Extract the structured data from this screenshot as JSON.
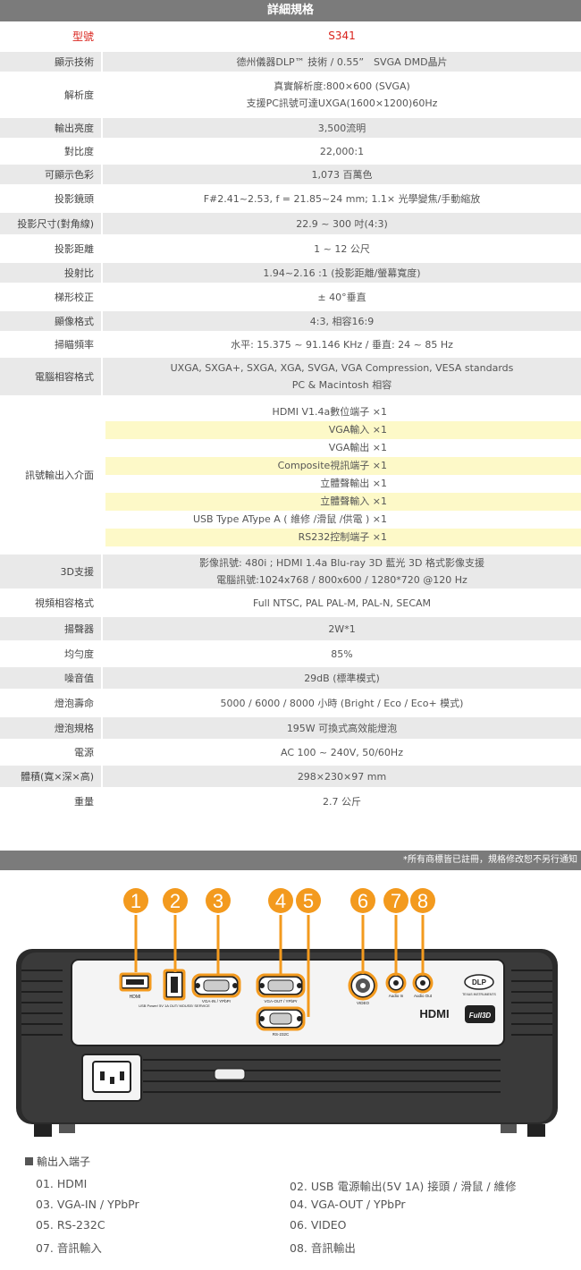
{
  "header": {
    "title": "詳細規格"
  },
  "specs": [
    {
      "label": "型號",
      "lines": [
        "S341"
      ],
      "style": "model"
    },
    {
      "label": "顯示技術",
      "lines": [
        "德州儀器DLP™ 技術 / 0.55”　SVGA DMD晶片"
      ]
    },
    {
      "label": "解析度",
      "lines": [
        "真實解析度:800×600 (SVGA)",
        "支援PC訊號可達UXGA(1600×1200)60Hz"
      ]
    },
    {
      "label": "輸出亮度",
      "lines": [
        "3,500流明"
      ]
    },
    {
      "label": "對比度",
      "lines": [
        "22,000:1"
      ]
    },
    {
      "label": "可顯示色彩",
      "lines": [
        "1,073 百萬色"
      ]
    },
    {
      "label": "投影鏡頭",
      "lines": [
        "F#2.41~2.53, f = 21.85~24 mm; 1.1× 光學變焦/手動縮放"
      ]
    },
    {
      "label": "投影尺寸(對角線)",
      "lines": [
        "22.9 ~ 300 吋(4:3)"
      ]
    },
    {
      "label": "投影距離",
      "lines": [
        "1 ~ 12 公尺"
      ]
    },
    {
      "label": "投射比",
      "lines": [
        "1.94~2.16 :1 (投影距離/螢幕寬度)"
      ]
    },
    {
      "label": "梯形校正",
      "lines": [
        "± 40°垂直"
      ]
    },
    {
      "label": "顯像格式",
      "lines": [
        "4:3, 相容16:9"
      ]
    },
    {
      "label": "掃瞄頻率",
      "lines": [
        "水平: 15.375 ~ 91.146 KHz / 垂直: 24 ~ 85 Hz"
      ]
    },
    {
      "label": "電腦相容格式",
      "lines": [
        "UXGA, SXGA+, SXGA, XGA, SVGA, VGA Compression, VESA standards",
        "PC & Macintosh 相容"
      ]
    },
    {
      "label": "訊號輸出入介面",
      "io": [
        "HDMI  V1.4a數位端子 ×1",
        "VGA輸入 ×1",
        "VGA輸出 ×1",
        "Composite視訊端子 ×1",
        "立體聲輸出 ×1",
        "立體聲輸入 ×1",
        "USB Type AType A ( 維修 /滑鼠 /供電 ) ×1",
        "RS232控制端子 ×1"
      ]
    },
    {
      "label": "3D支援",
      "lines": [
        "影像訊號: 480i ; HDMI 1.4a Blu-ray 3D 藍光 3D 格式影像支援",
        "電腦訊號:1024x768 / 800x600 / 1280*720 @120 Hz"
      ]
    },
    {
      "label": "視頻相容格式",
      "lines": [
        "Full NTSC, PAL PAL-M, PAL-N, SECAM"
      ]
    },
    {
      "label": "揚聲器",
      "lines": [
        "2W*1"
      ]
    },
    {
      "label": "均勻度",
      "lines": [
        "85%"
      ]
    },
    {
      "label": "噪音值",
      "lines": [
        "29dB (標準模式)"
      ]
    },
    {
      "label": "燈泡壽命",
      "lines": [
        "5000 / 6000 / 8000 小時 (Bright / Eco / Eco+ 模式)"
      ]
    },
    {
      "label": "燈泡規格",
      "lines": [
        "195W 可換式高效能燈泡"
      ]
    },
    {
      "label": "電源",
      "lines": [
        "AC 100 ~ 240V, 50/60Hz"
      ]
    },
    {
      "label": "體積(寬×深×高)",
      "lines": [
        "298×230×97 mm"
      ]
    },
    {
      "label": "重量",
      "lines": [
        "2.7 公斤"
      ]
    }
  ],
  "footer_note": "*所有商標皆已註冊，規格修改恕不另行通知",
  "diagram": {
    "markers": [
      "1",
      "2",
      "3",
      "4",
      "5",
      "6",
      "7",
      "8"
    ],
    "accent": "#f39a1e",
    "port_labels": [
      "HDMI",
      "USB Power/ 5V 1A OUT/ MOUSE/ SERVICE",
      "VGA-IN / YPbPr",
      "VGA-OUT / YPbPr",
      "RS-232C",
      "VIDEO",
      "Audio In",
      "Audio Out"
    ],
    "logos": {
      "dlp": "DLP",
      "dlp_sub": "TEXAS INSTRUMENTS",
      "hdmi": "HDMI",
      "full3d": "Full3D"
    }
  },
  "ports_section": {
    "title": "輸出入端子",
    "items": [
      "01. HDMI",
      "02. USB 電源輸出(5V 1A) 接頭 / 滑鼠 / 維修",
      "03. VGA-IN / YPbPr",
      "04. VGA-OUT / YPbPr",
      "05. RS-232C",
      "06. VIDEO",
      "07. 音訊輸入",
      "08. 音訊輸出"
    ]
  }
}
